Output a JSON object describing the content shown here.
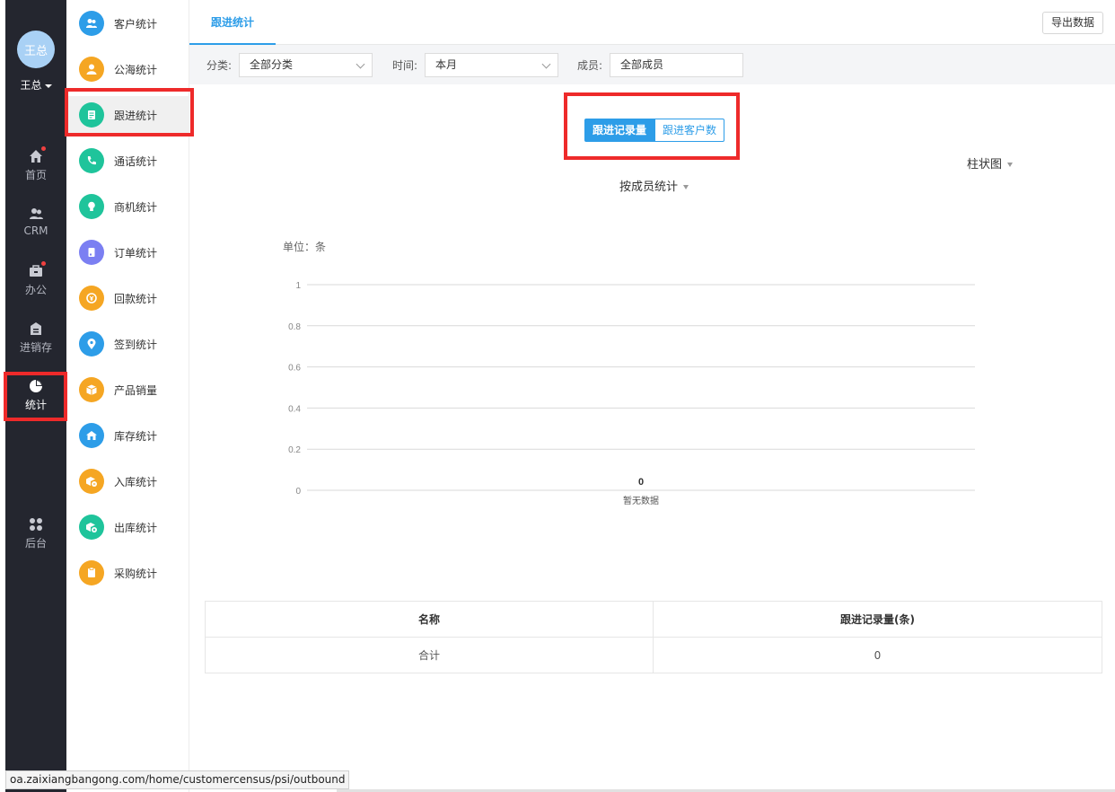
{
  "user": {
    "avatar_text": "王总",
    "name": "王总"
  },
  "main_nav": [
    {
      "label": "首页",
      "icon": "home-icon",
      "dot": true
    },
    {
      "label": "CRM",
      "icon": "users-icon",
      "dot": false
    },
    {
      "label": "办公",
      "icon": "briefcase-icon",
      "dot": true
    },
    {
      "label": "进销存",
      "icon": "warehouse-icon",
      "dot": false
    },
    {
      "label": "统计",
      "icon": "pie-chart-icon",
      "dot": false,
      "active": true
    },
    {
      "label": "后台",
      "icon": "grid-icon",
      "dot": false
    }
  ],
  "sub_nav": [
    {
      "label": "客户统计",
      "icon": "customer-icon",
      "color": "#2d9de8"
    },
    {
      "label": "公海统计",
      "icon": "person-icon",
      "color": "#f5a623"
    },
    {
      "label": "跟进统计",
      "icon": "followup-icon",
      "color": "#1fc49b",
      "active": true
    },
    {
      "label": "通话统计",
      "icon": "phone-icon",
      "color": "#1fc49b"
    },
    {
      "label": "商机统计",
      "icon": "lightbulb-icon",
      "color": "#1fc49b"
    },
    {
      "label": "订单统计",
      "icon": "order-icon",
      "color": "#7b7ff2"
    },
    {
      "label": "回款统计",
      "icon": "payment-icon",
      "color": "#f5a623"
    },
    {
      "label": "签到统计",
      "icon": "location-icon",
      "color": "#2d9de8"
    },
    {
      "label": "产品销量",
      "icon": "box-icon",
      "color": "#f5a623"
    },
    {
      "label": "库存统计",
      "icon": "stock-icon",
      "color": "#2d9de8"
    },
    {
      "label": "入库统计",
      "icon": "inbound-icon",
      "color": "#f5a623"
    },
    {
      "label": "出库统计",
      "icon": "outbound-icon",
      "color": "#1fc49b"
    },
    {
      "label": "采购统计",
      "icon": "purchase-icon",
      "color": "#f5a623"
    }
  ],
  "tab": {
    "label": "跟进统计"
  },
  "export_label": "导出数据",
  "filters": {
    "category_label": "分类:",
    "category_value": "全部分类",
    "time_label": "时间:",
    "time_value": "本月",
    "member_label": "成员:",
    "member_value": "全部成员"
  },
  "toggle": {
    "on": "跟进记录量",
    "off": "跟进客户数"
  },
  "chart_type_label": "柱状图",
  "group_by_label": "按成员统计",
  "chart_data": {
    "type": "bar",
    "unit_label": "单位：条",
    "categories": [
      "暂无数据"
    ],
    "values": [
      0
    ],
    "ylim": [
      0,
      1
    ],
    "yticks": [
      "1",
      "0.8",
      "0.6",
      "0.4",
      "0.2",
      "0"
    ],
    "grid": true
  },
  "table": {
    "headers": [
      "名称",
      "跟进记录量(条)"
    ],
    "rows": [
      [
        "合计",
        "0"
      ]
    ]
  },
  "status_url": "oa.zaixiangbangong.com/home/customercensus/psi/outbound",
  "accent_color": "#2d9de8",
  "highlight_color": "#ee2a2a"
}
